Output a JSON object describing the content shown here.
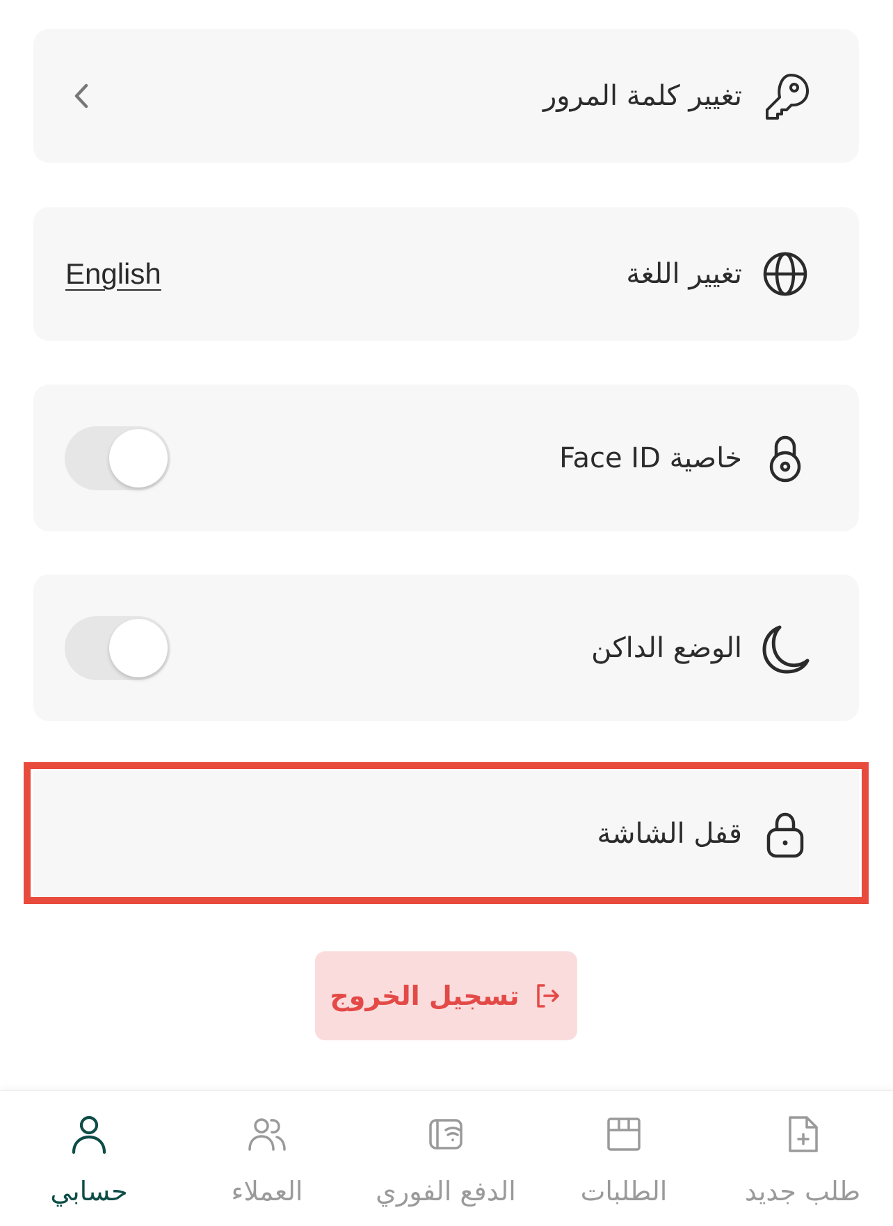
{
  "settings": {
    "change_password": {
      "label": "تغيير كلمة المرور",
      "icon": "key-icon"
    },
    "change_language": {
      "label": "تغيير اللغة",
      "icon": "globe-icon",
      "value": "English"
    },
    "face_id": {
      "label": "خاصية Face ID",
      "icon": "padlock-icon",
      "enabled": false
    },
    "dark_mode": {
      "label": "الوضع الداكن",
      "icon": "moon-icon",
      "enabled": false
    },
    "screen_lock": {
      "label": "قفل الشاشة",
      "icon": "lock-icon"
    }
  },
  "logout": {
    "label": "تسجيل الخروج",
    "icon": "logout-icon"
  },
  "bottom_nav": {
    "items": [
      {
        "label": "حسابي",
        "icon": "user-icon",
        "active": true
      },
      {
        "label": "العملاء",
        "icon": "users-icon",
        "active": false
      },
      {
        "label": "الدفع الفوري",
        "icon": "wallet-icon",
        "active": false
      },
      {
        "label": "الطلبات",
        "icon": "box-icon",
        "active": false
      },
      {
        "label": "طلب جديد",
        "icon": "file-plus-icon",
        "active": false
      }
    ]
  },
  "colors": {
    "card_bg": "#f7f7f7",
    "text": "#2b2b2b",
    "highlight": "#e84a3c",
    "logout_bg": "#fbdcdd",
    "logout_text": "#e34a47",
    "nav_active": "#0e4d47",
    "nav_inactive": "#9a9a9a"
  }
}
